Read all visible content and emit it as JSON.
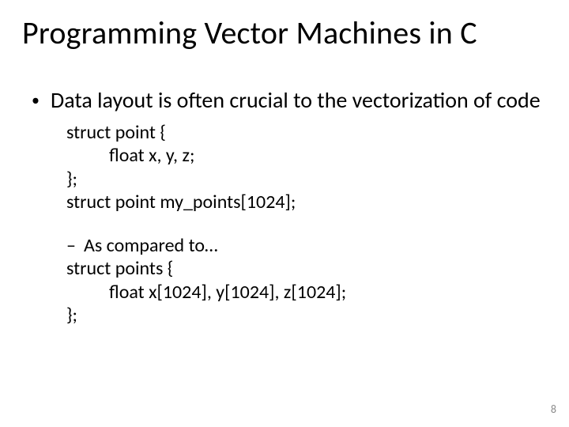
{
  "title": "Programming Vector Machines in C",
  "bullet1": "Data layout is often crucial to the vectorization of code",
  "code1": {
    "l1": "struct point {",
    "l2": "float x, y, z;",
    "l3": "};",
    "l4": "struct point my_points[1024];"
  },
  "bullet2": "As compared to…",
  "code2": {
    "l1": "struct points {",
    "l2": "float x[1024], y[1024], z[1024];",
    "l3": "};"
  },
  "page_number": "8"
}
